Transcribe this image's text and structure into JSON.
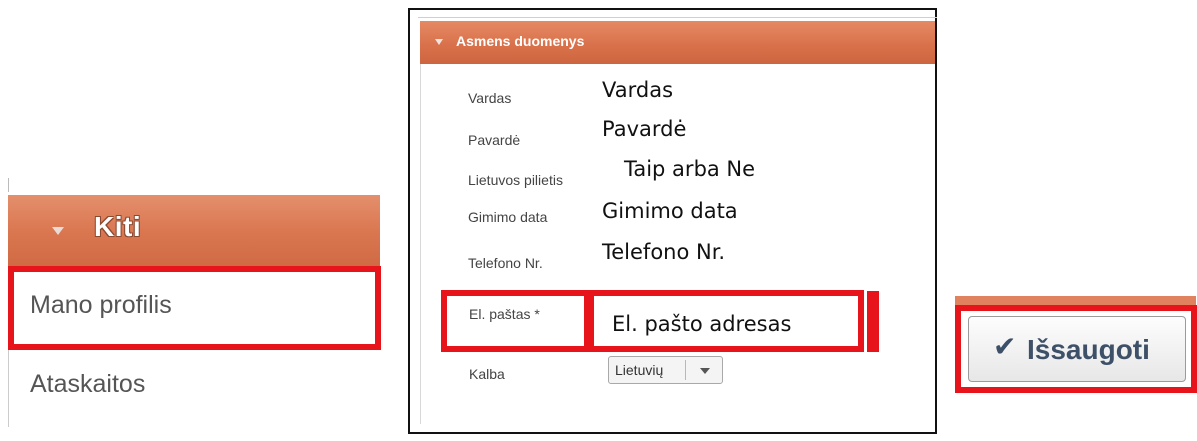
{
  "sidebar": {
    "section_title": "Kiti",
    "items": [
      {
        "label": "Mano profilis"
      },
      {
        "label": "Ataskaitos"
      }
    ]
  },
  "form": {
    "section_title": "Asmens duomenys",
    "fields": [
      {
        "label": "Vardas",
        "value": "Vardas"
      },
      {
        "label": "Pavardė",
        "value": "Pavardė"
      },
      {
        "label": "Lietuvos pilietis",
        "value": "Taip arba Ne"
      },
      {
        "label": "Gimimo data",
        "value": "Gimimo data"
      },
      {
        "label": "Telefono Nr.",
        "value": "Telefono Nr."
      },
      {
        "label": "El. paštas *",
        "value": "El. pašto adresas"
      }
    ],
    "language": {
      "label": "Kalba",
      "selected": "Lietuvių"
    }
  },
  "actions": {
    "save_label": "Išsaugoti",
    "save_icon": "check-icon"
  },
  "colors": {
    "accent": "#d9754f",
    "highlight": "#e8141b"
  }
}
